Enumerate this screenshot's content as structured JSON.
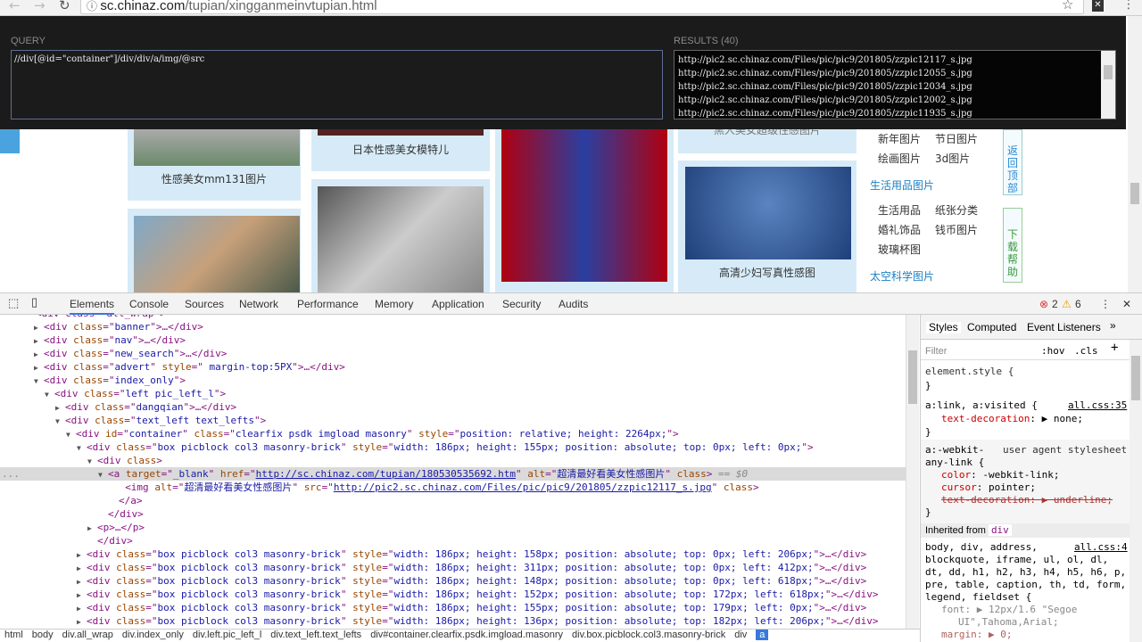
{
  "browser": {
    "url_host": "sc.chinaz.com",
    "url_path": "/tupian/xingganmeinvtupian.html"
  },
  "page": {
    "captions": [
      "性感美女mm131图片",
      "日本性感美女模特儿",
      "高清少妇写真性感图",
      "黑人美女超级性感图片"
    ],
    "sidebar": {
      "links1": [
        "新年图片",
        "节日图片",
        "绘画图片",
        "3d图片"
      ],
      "head2": "生活用品图片",
      "links2": [
        "生活用品",
        "纸张分类",
        "婚礼饰品",
        "钱币图片",
        "玻璃杯图"
      ],
      "head3": "太空科学图片"
    },
    "float_top": "返回顶部",
    "float_help": "下载帮助"
  },
  "xpath": {
    "query_label": "QUERY",
    "query": "//div[@id=\"container\"]/div/div/a/img/@src",
    "results_label": "RESULTS (40)",
    "results": [
      "http://pic2.sc.chinaz.com/Files/pic/pic9/201805/zzpic12117_s.jpg",
      "http://pic2.sc.chinaz.com/Files/pic/pic9/201805/zzpic12055_s.jpg",
      "http://pic2.sc.chinaz.com/Files/pic/pic9/201805/zzpic12034_s.jpg",
      "http://pic2.sc.chinaz.com/Files/pic/pic9/201805/zzpic12002_s.jpg",
      "http://pic2.sc.chinaz.com/Files/pic/pic9/201805/zzpic11935_s.jpg"
    ]
  },
  "devtools": {
    "tabs": [
      "Elements",
      "Console",
      "Sources",
      "Network",
      "Performance",
      "Memory",
      "Application",
      "Security",
      "Audits"
    ],
    "errors": "2",
    "warnings": "6",
    "tree": [
      {
        "i": 0,
        "a": "▶",
        "p": [
          [
            "tg",
            "<div "
          ],
          [
            "an",
            "class"
          ],
          [
            "tg",
            "=\""
          ],
          [
            "av",
            "banner"
          ],
          [
            "tg",
            "\">…</div>"
          ]
        ]
      },
      {
        "i": 0,
        "a": "▶",
        "p": [
          [
            "tg",
            "<div "
          ],
          [
            "an",
            "class"
          ],
          [
            "tg",
            "=\""
          ],
          [
            "av",
            "nav"
          ],
          [
            "tg",
            "\">…</div>"
          ]
        ]
      },
      {
        "i": 0,
        "a": "▶",
        "p": [
          [
            "tg",
            "<div "
          ],
          [
            "an",
            "class"
          ],
          [
            "tg",
            "=\""
          ],
          [
            "av",
            "new_search"
          ],
          [
            "tg",
            "\">…</div>"
          ]
        ]
      },
      {
        "i": 0,
        "a": "▶",
        "p": [
          [
            "tg",
            "<div "
          ],
          [
            "an",
            "class"
          ],
          [
            "tg",
            "=\""
          ],
          [
            "av",
            "advert"
          ],
          [
            "tg",
            "\" "
          ],
          [
            "an",
            "style"
          ],
          [
            "tg",
            "=\""
          ],
          [
            "av",
            " margin-top:5PX"
          ],
          [
            "tg",
            "\">…</div>"
          ]
        ]
      },
      {
        "i": 0,
        "a": "▼",
        "p": [
          [
            "tg",
            "<div "
          ],
          [
            "an",
            "class"
          ],
          [
            "tg",
            "=\""
          ],
          [
            "av",
            "index_only"
          ],
          [
            "tg",
            "\">"
          ]
        ]
      },
      {
        "i": 1,
        "a": "▼",
        "p": [
          [
            "tg",
            "<div "
          ],
          [
            "an",
            "class"
          ],
          [
            "tg",
            "=\""
          ],
          [
            "av",
            "left pic_left_l"
          ],
          [
            "tg",
            "\">"
          ]
        ]
      },
      {
        "i": 2,
        "a": "▶",
        "p": [
          [
            "tg",
            "<div "
          ],
          [
            "an",
            "class"
          ],
          [
            "tg",
            "=\""
          ],
          [
            "av",
            "dangqian"
          ],
          [
            "tg",
            "\">…</div>"
          ]
        ]
      },
      {
        "i": 2,
        "a": "▼",
        "p": [
          [
            "tg",
            "<div "
          ],
          [
            "an",
            "class"
          ],
          [
            "tg",
            "=\""
          ],
          [
            "av",
            "text_left text_lefts"
          ],
          [
            "tg",
            "\">"
          ]
        ]
      },
      {
        "i": 3,
        "a": "▼",
        "p": [
          [
            "tg",
            "<div "
          ],
          [
            "an",
            "id"
          ],
          [
            "tg",
            "=\""
          ],
          [
            "av",
            "container"
          ],
          [
            "tg",
            "\" "
          ],
          [
            "an",
            "class"
          ],
          [
            "tg",
            "=\""
          ],
          [
            "av",
            "clearfix psdk imgload masonry"
          ],
          [
            "tg",
            "\" "
          ],
          [
            "an",
            "style"
          ],
          [
            "tg",
            "=\""
          ],
          [
            "av",
            "position: relative; height: 2264px;"
          ],
          [
            "tg",
            "\">"
          ]
        ]
      },
      {
        "i": 4,
        "a": "▼",
        "p": [
          [
            "tg",
            "<div "
          ],
          [
            "an",
            "class"
          ],
          [
            "tg",
            "=\""
          ],
          [
            "av",
            "box picblock col3 masonry-brick"
          ],
          [
            "tg",
            "\" "
          ],
          [
            "an",
            "style"
          ],
          [
            "tg",
            "=\""
          ],
          [
            "av",
            "width: 186px; height: 155px; position: absolute; top: 0px; left: 0px;"
          ],
          [
            "tg",
            "\">"
          ]
        ]
      },
      {
        "i": 5,
        "a": "▼",
        "p": [
          [
            "tg",
            "<div "
          ],
          [
            "an",
            "class"
          ],
          [
            "tg",
            ">"
          ]
        ]
      },
      {
        "i": 6,
        "a": "▼",
        "sel": true,
        "p": [
          [
            "tg",
            "<a "
          ],
          [
            "an",
            "target"
          ],
          [
            "tg",
            "=\""
          ],
          [
            "av",
            "_blank"
          ],
          [
            "tg",
            "\" "
          ],
          [
            "an",
            "href"
          ],
          [
            "tg",
            "=\""
          ],
          [
            "lk",
            "http://sc.chinaz.com/tupian/180530535692.htm"
          ],
          [
            "tg",
            "\" "
          ],
          [
            "an",
            "alt"
          ],
          [
            "tg",
            "=\""
          ],
          [
            "av",
            "超清最好看美女性感图片"
          ],
          [
            "tg",
            "\" "
          ],
          [
            "an",
            "class"
          ],
          [
            "tg",
            "> "
          ],
          [
            "cm",
            "== $0"
          ]
        ]
      },
      {
        "i": 7.6,
        "a": "",
        "p": [
          [
            "tg",
            "<img "
          ],
          [
            "an",
            "alt"
          ],
          [
            "tg",
            "=\""
          ],
          [
            "av",
            "超清最好看美女性感图片"
          ],
          [
            "tg",
            "\" "
          ],
          [
            "an",
            "src"
          ],
          [
            "tg",
            "=\""
          ],
          [
            "lk",
            "http://pic2.sc.chinaz.com/Files/pic/pic9/201805/zzpic12117_s.jpg"
          ],
          [
            "tg",
            "\" "
          ],
          [
            "an",
            "class"
          ],
          [
            "tg",
            ">"
          ]
        ]
      },
      {
        "i": 7,
        "a": "",
        "p": [
          [
            "tg",
            "</a>"
          ]
        ]
      },
      {
        "i": 6,
        "a": "",
        "p": [
          [
            "tg",
            "</div>"
          ]
        ]
      },
      {
        "i": 5,
        "a": "▶",
        "p": [
          [
            "tg",
            "<p>…</p>"
          ]
        ]
      },
      {
        "i": 5,
        "a": "",
        "p": [
          [
            "tg",
            "</div>"
          ]
        ]
      },
      {
        "i": 4,
        "a": "▶",
        "p": [
          [
            "tg",
            "<div "
          ],
          [
            "an",
            "class"
          ],
          [
            "tg",
            "=\""
          ],
          [
            "av",
            "box picblock col3 masonry-brick"
          ],
          [
            "tg",
            "\" "
          ],
          [
            "an",
            "style"
          ],
          [
            "tg",
            "=\""
          ],
          [
            "av",
            "width: 186px; height: 158px; position: absolute; top: 0px; left: 206px;"
          ],
          [
            "tg",
            "\">…</div>"
          ]
        ]
      },
      {
        "i": 4,
        "a": "▶",
        "p": [
          [
            "tg",
            "<div "
          ],
          [
            "an",
            "class"
          ],
          [
            "tg",
            "=\""
          ],
          [
            "av",
            "box picblock col3 masonry-brick"
          ],
          [
            "tg",
            "\" "
          ],
          [
            "an",
            "style"
          ],
          [
            "tg",
            "=\""
          ],
          [
            "av",
            "width: 186px; height: 311px; position: absolute; top: 0px; left: 412px;"
          ],
          [
            "tg",
            "\">…</div>"
          ]
        ]
      },
      {
        "i": 4,
        "a": "▶",
        "p": [
          [
            "tg",
            "<div "
          ],
          [
            "an",
            "class"
          ],
          [
            "tg",
            "=\""
          ],
          [
            "av",
            "box picblock col3 masonry-brick"
          ],
          [
            "tg",
            "\" "
          ],
          [
            "an",
            "style"
          ],
          [
            "tg",
            "=\""
          ],
          [
            "av",
            "width: 186px; height: 148px; position: absolute; top: 0px; left: 618px;"
          ],
          [
            "tg",
            "\">…</div>"
          ]
        ]
      },
      {
        "i": 4,
        "a": "▶",
        "p": [
          [
            "tg",
            "<div "
          ],
          [
            "an",
            "class"
          ],
          [
            "tg",
            "=\""
          ],
          [
            "av",
            "box picblock col3 masonry-brick"
          ],
          [
            "tg",
            "\" "
          ],
          [
            "an",
            "style"
          ],
          [
            "tg",
            "=\""
          ],
          [
            "av",
            "width: 186px; height: 152px; position: absolute; top: 172px; left: 618px;"
          ],
          [
            "tg",
            "\">…</div>"
          ]
        ]
      },
      {
        "i": 4,
        "a": "▶",
        "p": [
          [
            "tg",
            "<div "
          ],
          [
            "an",
            "class"
          ],
          [
            "tg",
            "=\""
          ],
          [
            "av",
            "box picblock col3 masonry-brick"
          ],
          [
            "tg",
            "\" "
          ],
          [
            "an",
            "style"
          ],
          [
            "tg",
            "=\""
          ],
          [
            "av",
            "width: 186px; height: 155px; position: absolute; top: 179px; left: 0px;"
          ],
          [
            "tg",
            "\">…</div>"
          ]
        ]
      },
      {
        "i": 4,
        "a": "▶",
        "p": [
          [
            "tg",
            "<div "
          ],
          [
            "an",
            "class"
          ],
          [
            "tg",
            "=\""
          ],
          [
            "av",
            "box picblock col3 masonry-brick"
          ],
          [
            "tg",
            "\" "
          ],
          [
            "an",
            "style"
          ],
          [
            "tg",
            "=\""
          ],
          [
            "av",
            "width: 186px; height: 136px; position: absolute; top: 182px; left: 206px;"
          ],
          [
            "tg",
            "\">…</div>"
          ]
        ]
      }
    ],
    "styles_tabs": [
      "Styles",
      "Computed",
      "Event Listeners",
      "»"
    ],
    "filter": "Filter",
    "hov": ":hov",
    "cls": ".cls",
    "plus": "+",
    "styles": {
      "element_style": "element.style {",
      "close": "}",
      "r1_sel": "a:link, a:visited {",
      "r1_src": "all.css:35",
      "r1_prop": "text-decoration",
      "r1_val": ": ▶ none;",
      "r2_sel1": "a:-webkit-",
      "r2_src": "user agent stylesheet",
      "r2_sel2": "any-link {",
      "r2_p1": "color",
      "r2_v1": ": -webkit-link;",
      "r2_p2": "cursor",
      "r2_v2": ": pointer;",
      "r2_p3": "text-decoration: ▶ underline;",
      "inherited": "Inherited from",
      "inherited_tag": "div",
      "r3_l1": "body, div, address,",
      "r3_src": "all.css:4",
      "r3_l2": "blockquote, iframe, ul, ol, dl,",
      "r3_l3": "dt, dd, h1, h2, h3, h4, h5, h6, p,",
      "r3_l4": "pre, table, caption, th, td, form,",
      "r3_l5": "legend, fieldset {",
      "r3_p1": "font: ▶ 12px/1.6 \"Segoe",
      "r3_p1b": "UI\",Tahoma,Arial;",
      "r3_p2": "margin: ▶ 0;"
    },
    "breadcrumbs": [
      "html",
      "body",
      "div.all_wrap",
      "div.index_only",
      "div.left.pic_left_l",
      "div.text_left.text_lefts",
      "div#container.clearfix.psdk.imgload.masonry",
      "div.box.picblock.col3.masonry-brick",
      "div",
      "a"
    ]
  }
}
